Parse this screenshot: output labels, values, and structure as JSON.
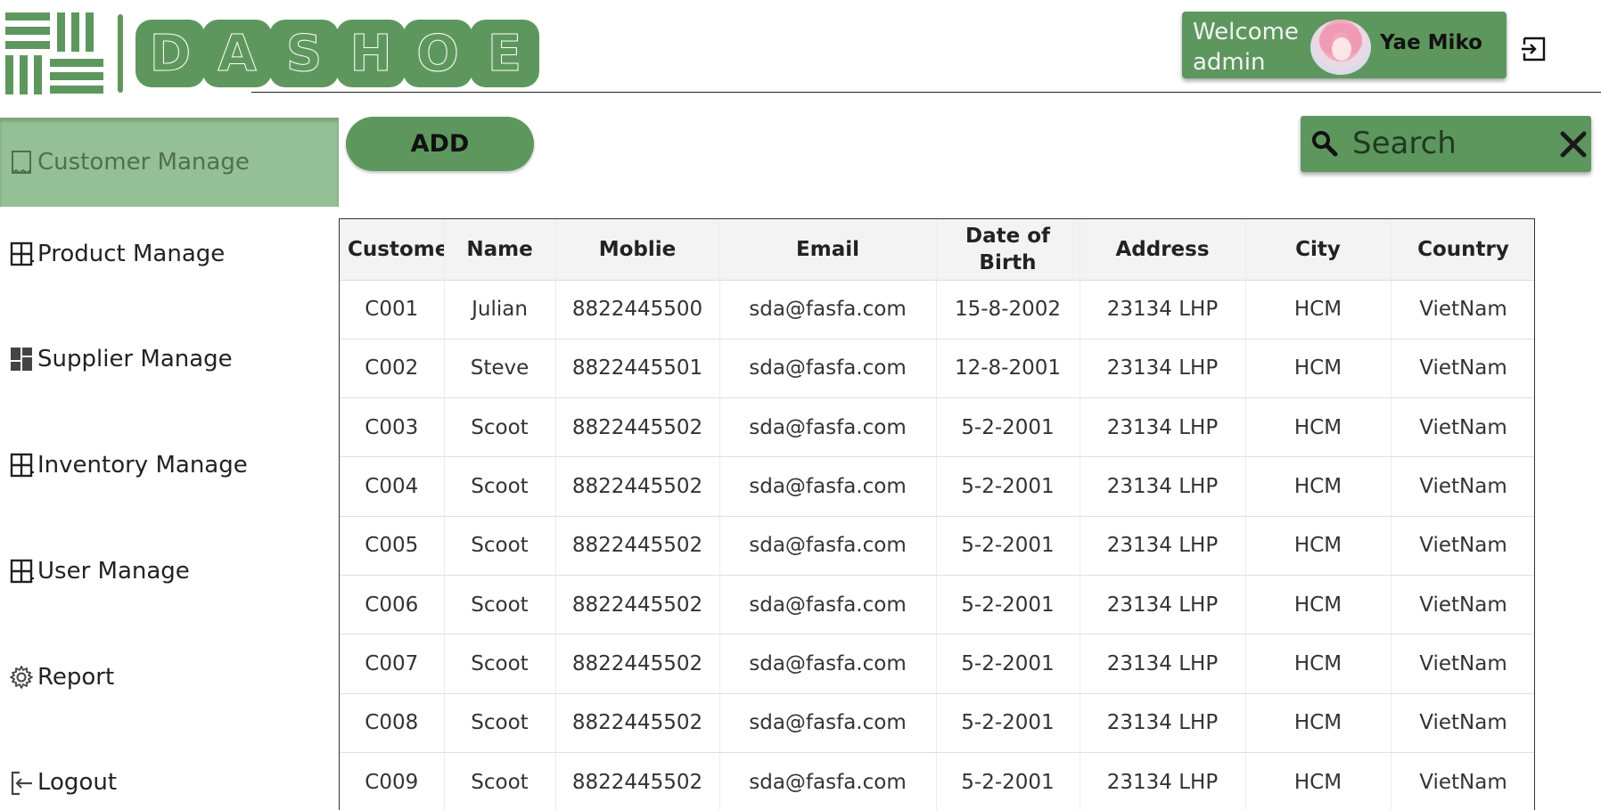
{
  "brand": {
    "name": "DASHOE",
    "letters": [
      "D",
      "A",
      "S",
      "H",
      "O",
      "E"
    ],
    "color": "#5e975e"
  },
  "header": {
    "welcome_line1": "Welcome",
    "welcome_line2": "admin",
    "user_name": "Yae Miko",
    "logout_icon": "logout-icon"
  },
  "sidebar": {
    "active_color": "#95c095",
    "items": [
      {
        "label": "Customer Manage",
        "icon": "document-icon",
        "active": true
      },
      {
        "label": "Product Manage",
        "icon": "layout-icon",
        "active": false
      },
      {
        "label": "Supplier Manage",
        "icon": "dashboard-icon",
        "active": false
      },
      {
        "label": "Inventory Manage",
        "icon": "layout-icon",
        "active": false
      },
      {
        "label": "User Manage",
        "icon": "layout-icon",
        "active": false
      },
      {
        "label": "Report",
        "icon": "gear-icon",
        "active": false
      },
      {
        "label": "Logout",
        "icon": "logout-icon",
        "active": false
      }
    ]
  },
  "toolbar": {
    "add_label": "ADD",
    "search_placeholder": "Search"
  },
  "table": {
    "columns": [
      "Customer",
      "Name",
      "Moblie",
      "Email",
      "Date of Birth",
      "Address",
      "City",
      "Country"
    ],
    "rows": [
      [
        "C001",
        "Julian",
        "8822445500",
        "sda@fasfa.com",
        "15-8-2002",
        "23134 LHP",
        "HCM",
        "VietNam"
      ],
      [
        "C002",
        "Steve",
        "8822445501",
        "sda@fasfa.com",
        "12-8-2001",
        "23134 LHP",
        "HCM",
        "VietNam"
      ],
      [
        "C003",
        "Scoot",
        "8822445502",
        "sda@fasfa.com",
        "5-2-2001",
        "23134 LHP",
        "HCM",
        "VietNam"
      ],
      [
        "C004",
        "Scoot",
        "8822445502",
        "sda@fasfa.com",
        "5-2-2001",
        "23134 LHP",
        "HCM",
        "VietNam"
      ],
      [
        "C005",
        "Scoot",
        "8822445502",
        "sda@fasfa.com",
        "5-2-2001",
        "23134 LHP",
        "HCM",
        "VietNam"
      ],
      [
        "C006",
        "Scoot",
        "8822445502",
        "sda@fasfa.com",
        "5-2-2001",
        "23134 LHP",
        "HCM",
        "VietNam"
      ],
      [
        "C007",
        "Scoot",
        "8822445502",
        "sda@fasfa.com",
        "5-2-2001",
        "23134 LHP",
        "HCM",
        "VietNam"
      ],
      [
        "C008",
        "Scoot",
        "8822445502",
        "sda@fasfa.com",
        "5-2-2001",
        "23134 LHP",
        "HCM",
        "VietNam"
      ],
      [
        "C009",
        "Scoot",
        "8822445502",
        "sda@fasfa.com",
        "5-2-2001",
        "23134 LHP",
        "HCM",
        "VietNam"
      ]
    ]
  }
}
